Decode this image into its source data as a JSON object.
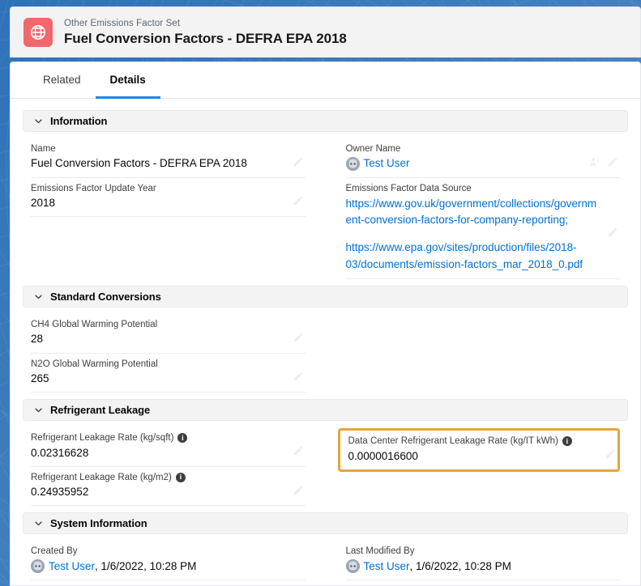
{
  "header": {
    "icon_name": "globe-icon",
    "icon_color": "#f2676b",
    "record_type": "Other Emissions Factor Set",
    "title": "Fuel Conversion Factors - DEFRA EPA 2018"
  },
  "tabs": [
    {
      "label": "Related",
      "active": false
    },
    {
      "label": "Details",
      "active": true
    }
  ],
  "accent_color": "#1589ee",
  "link_color": "#0070d2",
  "highlight_color": "#e8a33d",
  "sections": [
    {
      "id": "information",
      "title": "Information",
      "left_fields": [
        {
          "label": "Name",
          "value": "Fuel Conversion Factors - DEFRA EPA 2018",
          "editable": true
        },
        {
          "label": "Emissions Factor Update Year",
          "value": "2018",
          "editable": true
        }
      ],
      "right_fields": [
        {
          "label": "Owner Name",
          "value": "Test User",
          "type": "user",
          "editable": true,
          "change_owner": true
        },
        {
          "label": "Emissions Factor Data Source",
          "type": "links",
          "editable": true,
          "links": [
            "https://www.gov.uk/government/collections/government-conversion-factors-for-company-reporting;",
            "https://www.epa.gov/sites/production/files/2018-03/documents/emission-factors_mar_2018_0.pdf"
          ]
        }
      ]
    },
    {
      "id": "standard-conversions",
      "title": "Standard Conversions",
      "left_fields": [
        {
          "label": "CH4 Global Warming Potential",
          "value": "28",
          "editable": true
        },
        {
          "label": "N2O Global Warming Potential",
          "value": "265",
          "editable": true
        }
      ],
      "right_fields": []
    },
    {
      "id": "refrigerant-leakage",
      "title": "Refrigerant Leakage",
      "left_fields": [
        {
          "label": "Refrigerant Leakage Rate (kg/sqft)",
          "value": "0.02316628",
          "info": true,
          "editable": true
        },
        {
          "label": "Refrigerant Leakage Rate (kg/m2)",
          "value": "0.24935952",
          "info": true,
          "editable": true
        }
      ],
      "right_fields": [
        {
          "label": "Data Center Refrigerant Leakage Rate (kg/IT kWh)",
          "value": "0.0000016600",
          "info": true,
          "editable": true,
          "highlighted": true
        }
      ]
    },
    {
      "id": "system-information",
      "title": "System Information",
      "left_fields": [
        {
          "label": "Created By",
          "value": "Test User",
          "meta": ", 1/6/2022, 10:28 PM",
          "type": "user"
        }
      ],
      "right_fields": [
        {
          "label": "Last Modified By",
          "value": "Test User",
          "meta": ", 1/6/2022, 10:28 PM",
          "type": "user"
        }
      ]
    }
  ]
}
